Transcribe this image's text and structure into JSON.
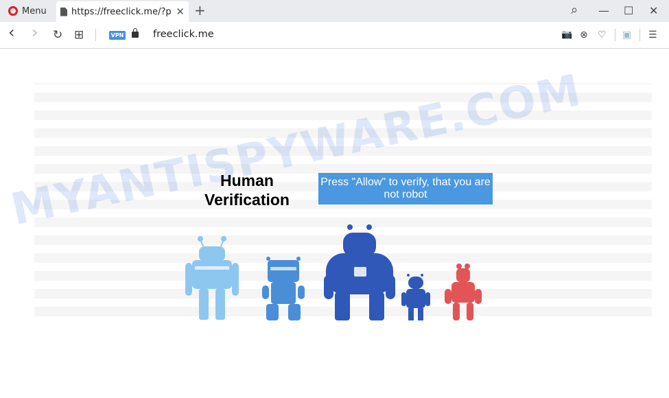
{
  "browser": {
    "menu_label": "Menu",
    "tab_title": "https://freeclick.me/?p",
    "tab_close": "✕",
    "new_tab": "+",
    "controls": {
      "search": "⌕",
      "minimize": "—",
      "maximize": "☐",
      "close": "✕"
    },
    "nav": {
      "back": "‹",
      "forward": "›",
      "reload": "↻",
      "tabs": "⊞"
    },
    "vpn_badge": "VPN",
    "url": "freeclick.me",
    "tools": {
      "snapshot": "📷",
      "block": "⊗",
      "heart": "♡",
      "ext": "▣",
      "settings": "☰"
    }
  },
  "page": {
    "title_line1": "Human",
    "title_line2": "Verification",
    "allow_text": "Press \"Allow\" to verify, that you are not robot",
    "watermark": "MYANTISPYWARE.COM"
  },
  "colors": {
    "robot_light": "#8dc7ef",
    "robot_mid": "#4a8ed8",
    "robot_dark": "#3058b8",
    "robot_red": "#e25456",
    "accent": "#4a98e0"
  }
}
